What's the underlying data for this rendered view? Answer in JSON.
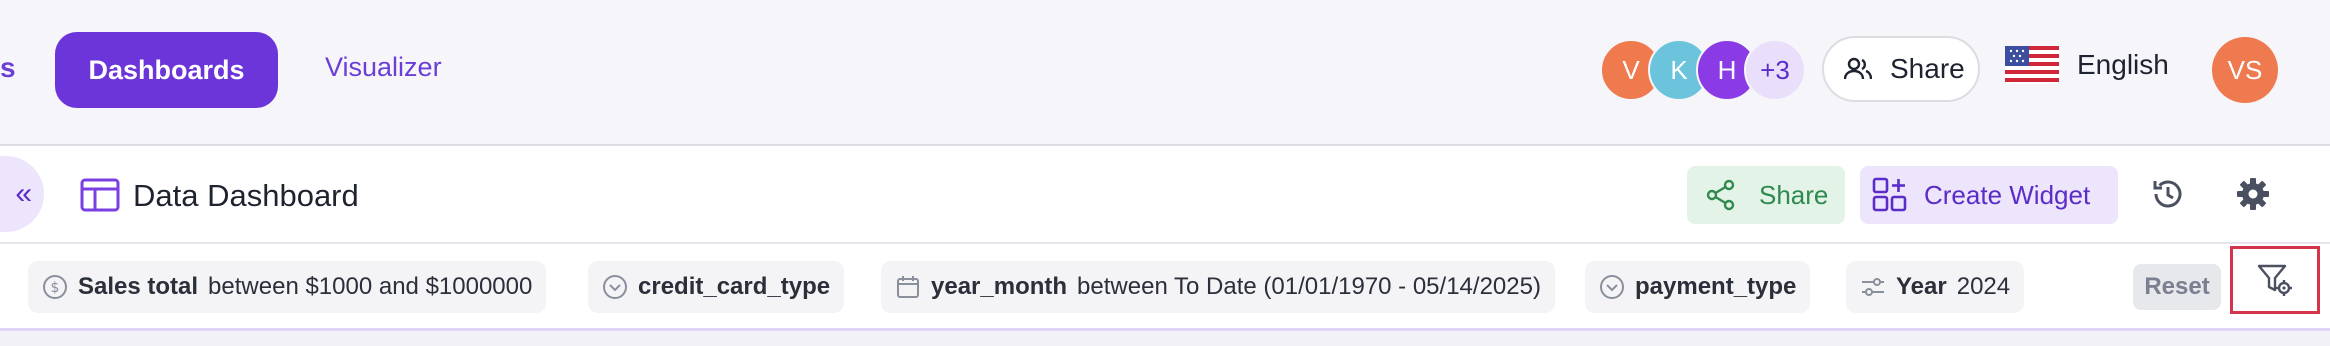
{
  "nav": {
    "partial_item": "s",
    "dashboards": "Dashboards",
    "visualizer": "Visualizer"
  },
  "collaborators": [
    {
      "initial": "V",
      "color": "#ef7a4e"
    },
    {
      "initial": "K",
      "color": "#6cc4dc"
    },
    {
      "initial": "H",
      "color": "#8b3be6"
    }
  ],
  "collaborators_more": "+3",
  "share_button": "Share",
  "language": "English",
  "user_initials": "VS",
  "dashboard": {
    "collapse_glyph": "«",
    "title": "Data Dashboard",
    "share_label": "Share",
    "create_widget_label": "Create Widget"
  },
  "filters": [
    {
      "name": "Sales total",
      "value": "between  $1000 and $1000000",
      "icon": "dollar-circle-icon"
    },
    {
      "name": "credit_card_type",
      "value": "",
      "icon": "chevron-circle-icon"
    },
    {
      "name": "year_month",
      "value": "between  To Date (01/01/1970 - 05/14/2025)",
      "icon": "calendar-icon"
    },
    {
      "name": "payment_type",
      "value": "",
      "icon": "chevron-circle-icon"
    },
    {
      "name": "Year",
      "value": "2024",
      "icon": "sliders-icon"
    }
  ],
  "reset_label": "Reset",
  "colors": {
    "accent": "#6b35d9",
    "share_green": "#2f8a4d",
    "highlight_red": "#d4344c"
  }
}
